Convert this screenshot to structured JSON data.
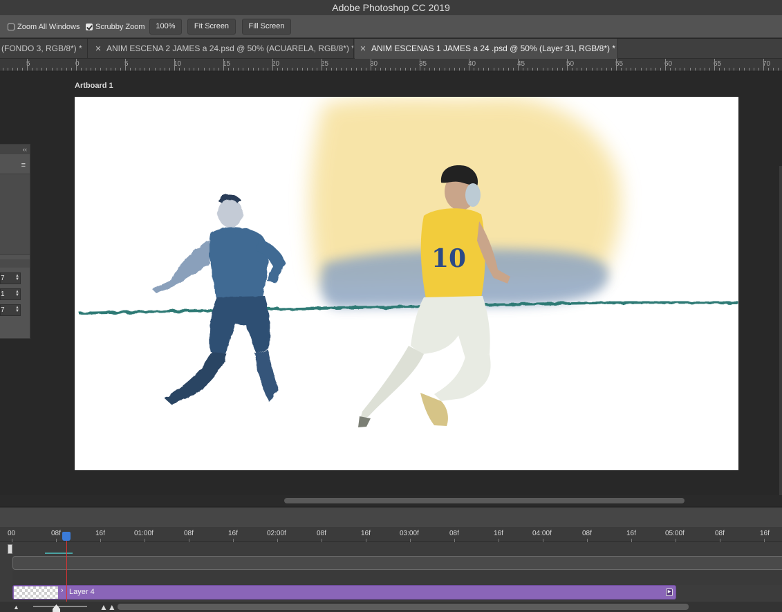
{
  "window": {
    "title": "Adobe Photoshop CC 2019"
  },
  "options_bar": {
    "zoom_all_windows": {
      "label": "Zoom All Windows",
      "checked": false
    },
    "scrubby_zoom": {
      "label": "Scrubby Zoom",
      "checked": true
    },
    "zoom_100": "100%",
    "fit_screen": "Fit Screen",
    "fill_screen": "Fill Screen"
  },
  "tabs": [
    {
      "label": "(FONDO 3, RGB/8*) *",
      "active": false
    },
    {
      "label": "ANIM ESCENA 2 JAMES a 24.psd @ 50% (ACUARELA, RGB/8*) *",
      "active": false
    },
    {
      "label": "ANIM ESCENAS 1 JAMES a 24 .psd @ 50% (Layer 31, RGB/8*) *",
      "active": true
    }
  ],
  "tab_close_glyph": "✕",
  "ruler": {
    "labels": [
      "5",
      "0",
      "5",
      "10",
      "15",
      "20",
      "25",
      "30",
      "35",
      "40",
      "45",
      "50",
      "55",
      "60",
      "65",
      "70"
    ]
  },
  "artboard": {
    "label": "Artboard 1"
  },
  "panel": {
    "collapse_glyph": "‹‹",
    "menu_glyph": "≡",
    "fields": [
      "7",
      "1",
      "7"
    ]
  },
  "timeline": {
    "labels": [
      "00",
      "08f",
      "16f",
      "01:00f",
      "08f",
      "16f",
      "02:00f",
      "08f",
      "16f",
      "03:00f",
      "08f",
      "16f",
      "04:00f",
      "08f",
      "16f",
      "05:00f",
      "08f",
      "16f"
    ],
    "layer_name": "Layer 4",
    "chevron_glyph": "›",
    "zoom_small_glyph": "▲",
    "zoom_large_glyph": "▲▲"
  },
  "colors": {
    "jersey_yellow": "#f2cc3c",
    "rival_blue": "#3f6a93",
    "ground_green": "#2f7a74",
    "watercolor_yellow": "#f5dc8c",
    "watercolor_blue": "#8fa6c2",
    "clip_purple": "#8a65b8",
    "playhead_blue": "#3b7bd8"
  }
}
